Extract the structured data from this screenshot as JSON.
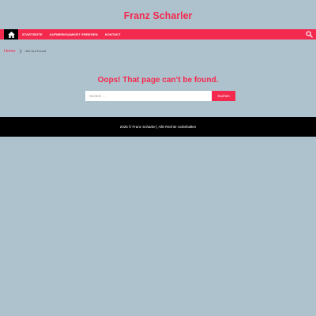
{
  "site": {
    "title": "Franz Scharler"
  },
  "nav": {
    "home_icon": "home-icon",
    "items": [
      {
        "label": "STARTSEITE"
      },
      {
        "label": "AUFMERKSAMKEIT ERREGEN"
      },
      {
        "label": "KONTAKT"
      }
    ],
    "search_icon": "search-icon"
  },
  "breadcrumb": {
    "home": "Home",
    "current": "404 Not Found"
  },
  "main": {
    "error_title": "Oops! That page can’t be found.",
    "search": {
      "placeholder": "Suchen …",
      "button": "Suchen"
    }
  },
  "footer": {
    "copyright": "2025 © Franz Scharler | Alle Rechte vorbehalten"
  },
  "colors": {
    "accent": "#f4294e",
    "background": "#aec2cd",
    "footer_bg": "#000000"
  }
}
